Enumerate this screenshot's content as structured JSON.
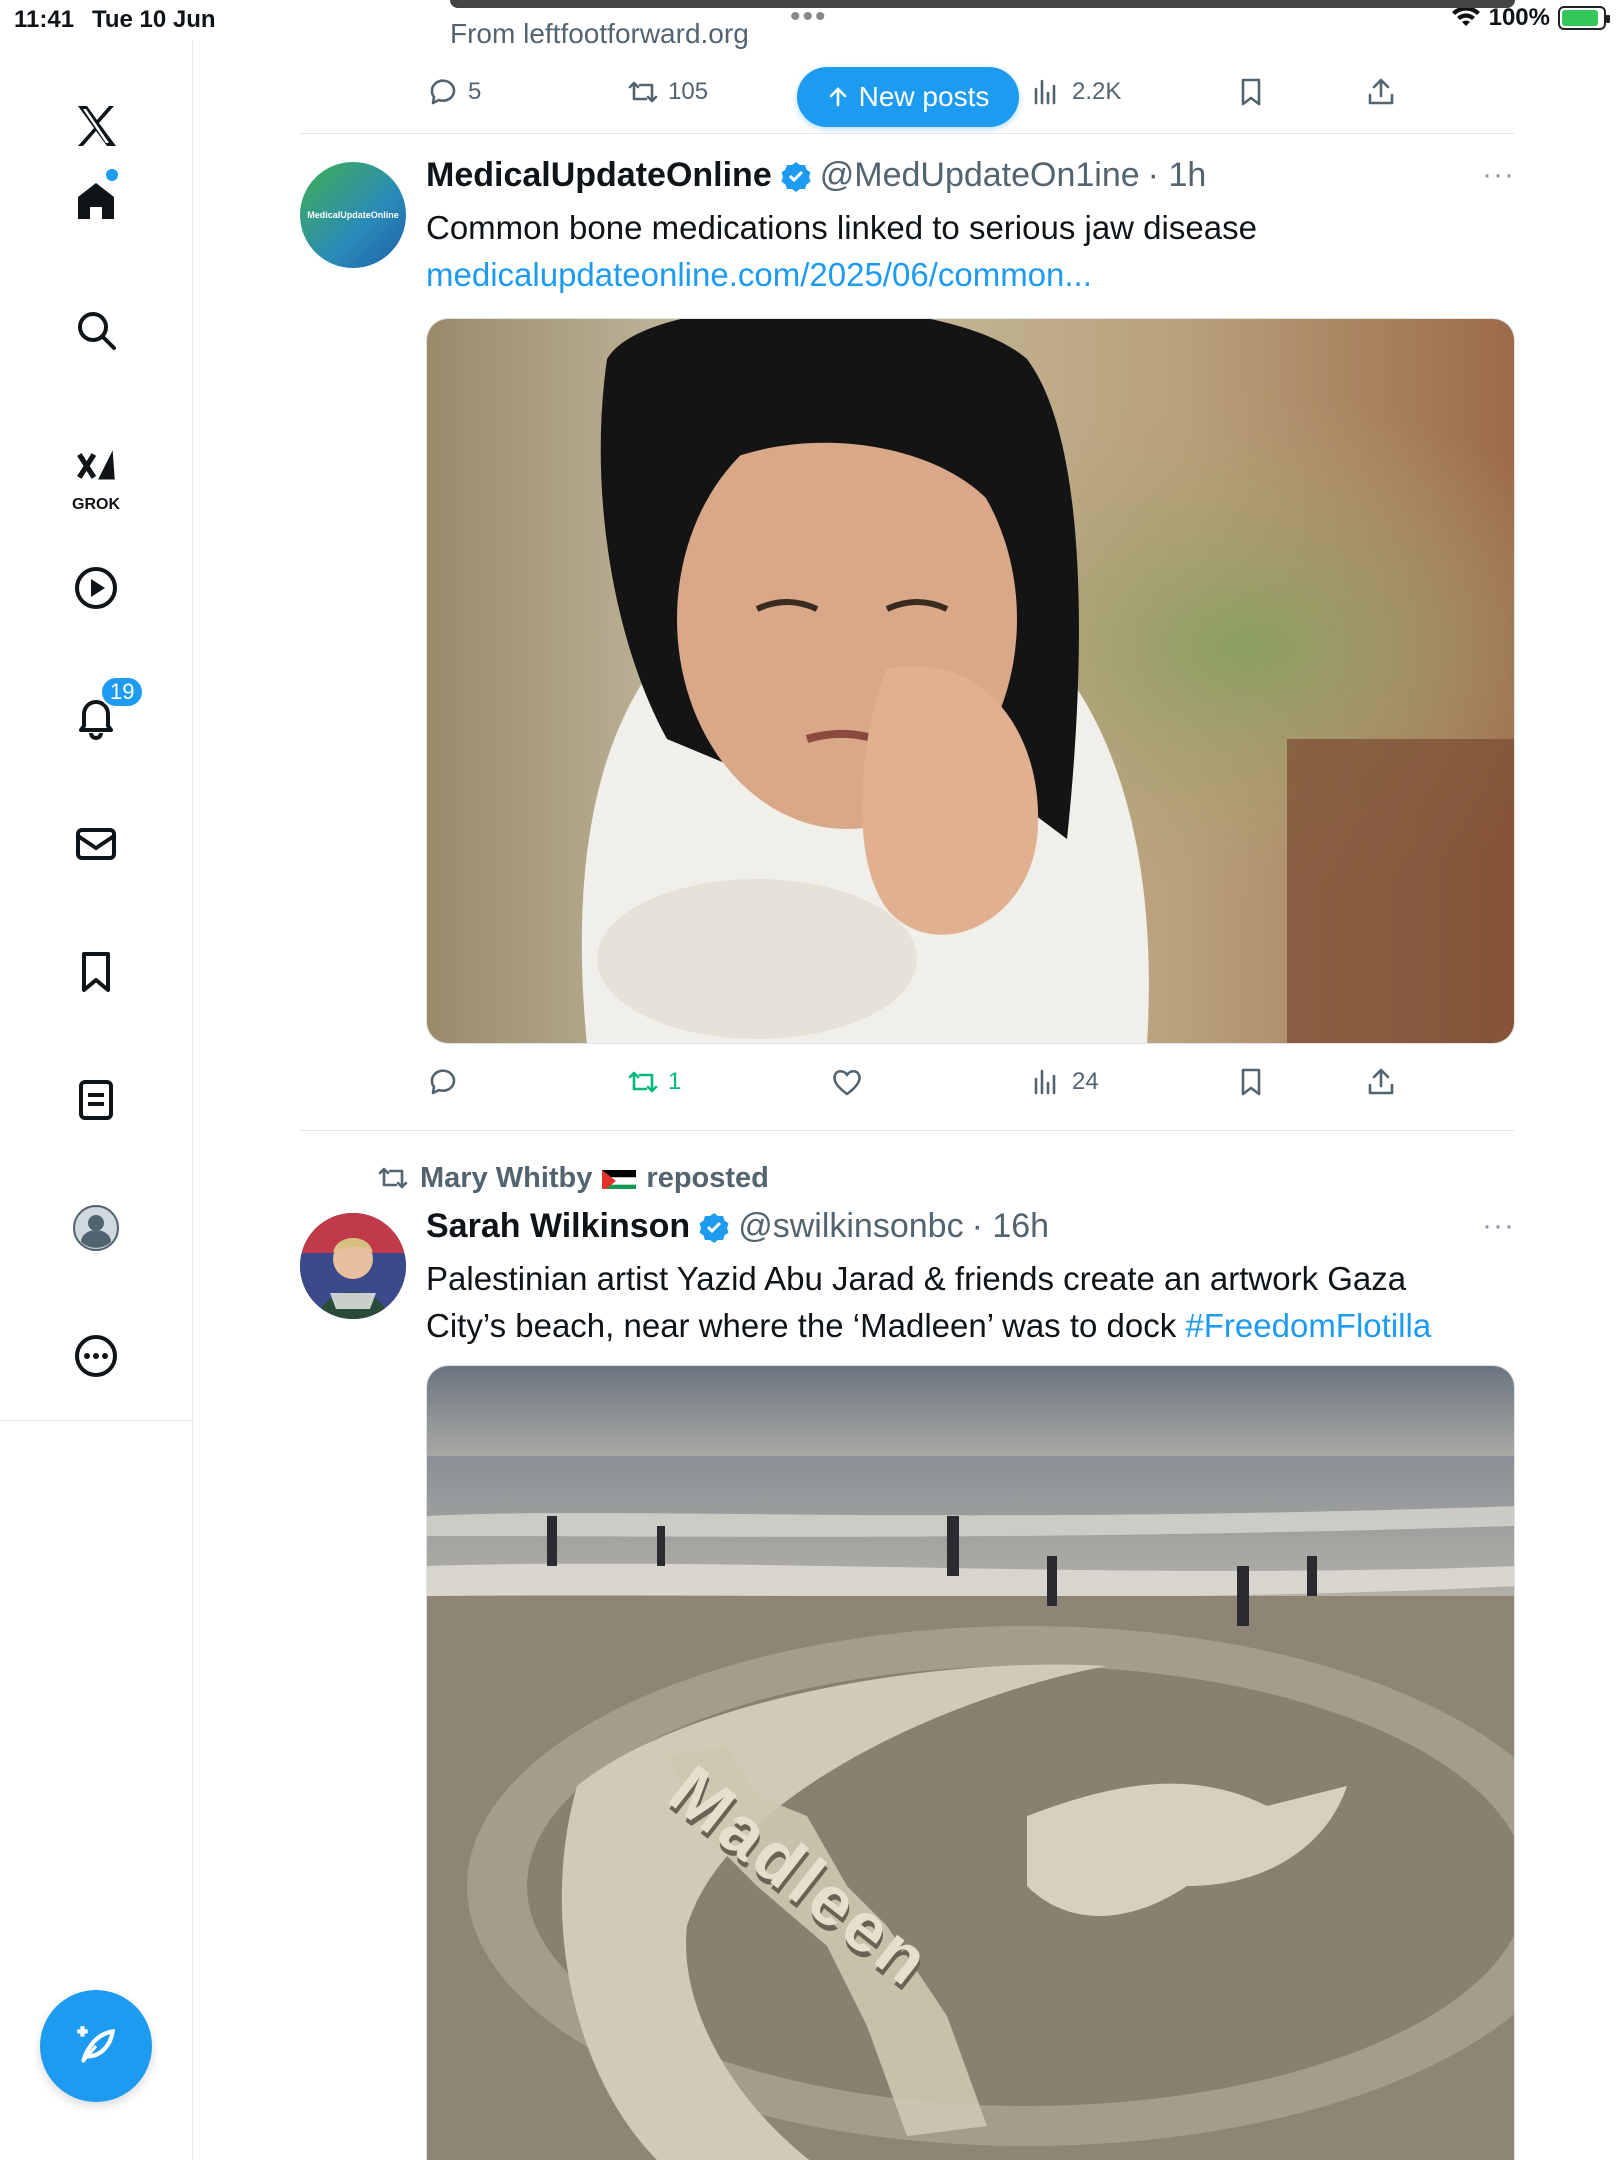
{
  "status": {
    "time": "11:41",
    "date": "Tue 10 Jun",
    "battery": "100%"
  },
  "sidebar": {
    "notification_count": "19",
    "grok_label": "GROK"
  },
  "previous_post": {
    "source": "From leftfootforward.org",
    "replies": "5",
    "reposts": "105",
    "views": "2.2K"
  },
  "new_posts_label": "New posts",
  "posts": [
    {
      "name": "MedicalUpdateOnline",
      "handle": "@MedUpdateOn1ine",
      "time": "· 1h",
      "avatar_text": "MedicalUpdateOnline",
      "text": "Common bone medications linked to serious jaw disease",
      "link": "medicalupdateonline.com/2025/06/common...",
      "replies": "",
      "reposts": "1",
      "likes": "",
      "views": "24"
    },
    {
      "repost_by": "Mary Whitby",
      "repost_suffix": "reposted",
      "name": "Sarah Wilkinson",
      "handle": "@swilkinsonbc",
      "time": "· 16h",
      "text_line1": "Palestinian artist Yazid Abu Jarad & friends create an artwork Gaza",
      "text_line2": "City’s beach, near where the ‘Madleen’ was to dock ",
      "hashtag": "#FreedomFlotilla",
      "sand_text": "Madleen"
    }
  ],
  "colors": {
    "accent": "#1d9bf0",
    "repost_green": "#00ba7c",
    "muted": "#536471"
  },
  "more_glyph": "···"
}
